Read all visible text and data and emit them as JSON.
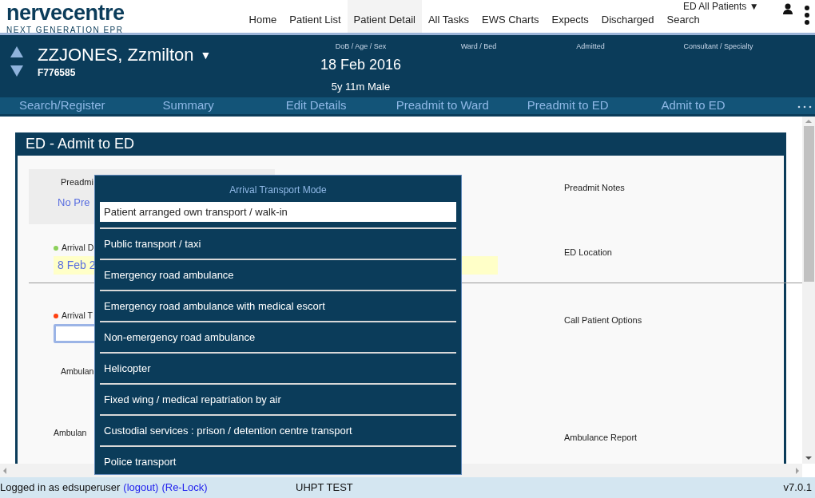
{
  "header": {
    "logo": "nervecentre",
    "tagline": "NEXT GENERATION EPR",
    "list_picker": {
      "label": "ED All Patients",
      "caret": "▼"
    },
    "nav": [
      {
        "label": "Home",
        "selected": false
      },
      {
        "label": "Patient List",
        "selected": false
      },
      {
        "label": "Patient Detail",
        "selected": true
      },
      {
        "label": "All Tasks",
        "selected": false
      },
      {
        "label": "EWS Charts",
        "selected": false
      },
      {
        "label": "Expects",
        "selected": false
      },
      {
        "label": "Discharged",
        "selected": false
      },
      {
        "label": "Search",
        "selected": false
      }
    ]
  },
  "patient": {
    "name": "ZZJONES, Zzmilton",
    "caret": "▼",
    "id": "F776585",
    "fields": [
      {
        "label": "DoB / Age / Sex",
        "value": "18 Feb 2016",
        "sub": "5y 11m Male"
      },
      {
        "label": "Ward / Bed"
      },
      {
        "label": "Admitted"
      },
      {
        "label": "Consultant / Specialty"
      }
    ]
  },
  "actions": [
    "Search/Register",
    "Summary",
    "Edit Details",
    "Preadmit to Ward",
    "Preadmit to ED",
    "Admit to ED"
  ],
  "form": {
    "title": "ED - Admit to ED",
    "preadmit": {
      "label": "Preadmi",
      "value": "No Pre"
    },
    "rows": [
      {
        "label": "Arrival D",
        "color": "#8cd05a",
        "value": "8 Feb 2",
        "kind": "filled",
        "right": "ED Location"
      },
      {
        "label": "Arrival T",
        "color": "#ff4010",
        "kind": "focused",
        "right": "Call Patient Options"
      },
      {
        "label": "Ambulan",
        "kind": "plain"
      },
      {
        "label": "Ambulan",
        "kind": "plain",
        "right": "Ambulance Report"
      }
    ],
    "notes_label": "Preadmit Notes"
  },
  "popup": {
    "title": "Arrival Transport Mode",
    "options": [
      {
        "label": "Patient arranged own transport / walk-in",
        "selected": true
      },
      {
        "label": "Public transport / taxi",
        "selected": false
      },
      {
        "label": "Emergency road ambulance",
        "selected": false
      },
      {
        "label": "Emergency road ambulance with medical escort",
        "selected": false
      },
      {
        "label": "Non-emergency road ambulance",
        "selected": false
      },
      {
        "label": "Helicopter",
        "selected": false
      },
      {
        "label": "Fixed wing / medical repatriation by air",
        "selected": false
      },
      {
        "label": "Custodial services : prison / detention centre transport",
        "selected": false
      },
      {
        "label": "Police transport",
        "selected": false
      }
    ]
  },
  "status_bar": {
    "text": "Logged in as edsuperuser",
    "links": [
      "(logout)",
      "(Re-Lock)"
    ],
    "site": "UHPT TEST",
    "version": "v7.0.1"
  }
}
